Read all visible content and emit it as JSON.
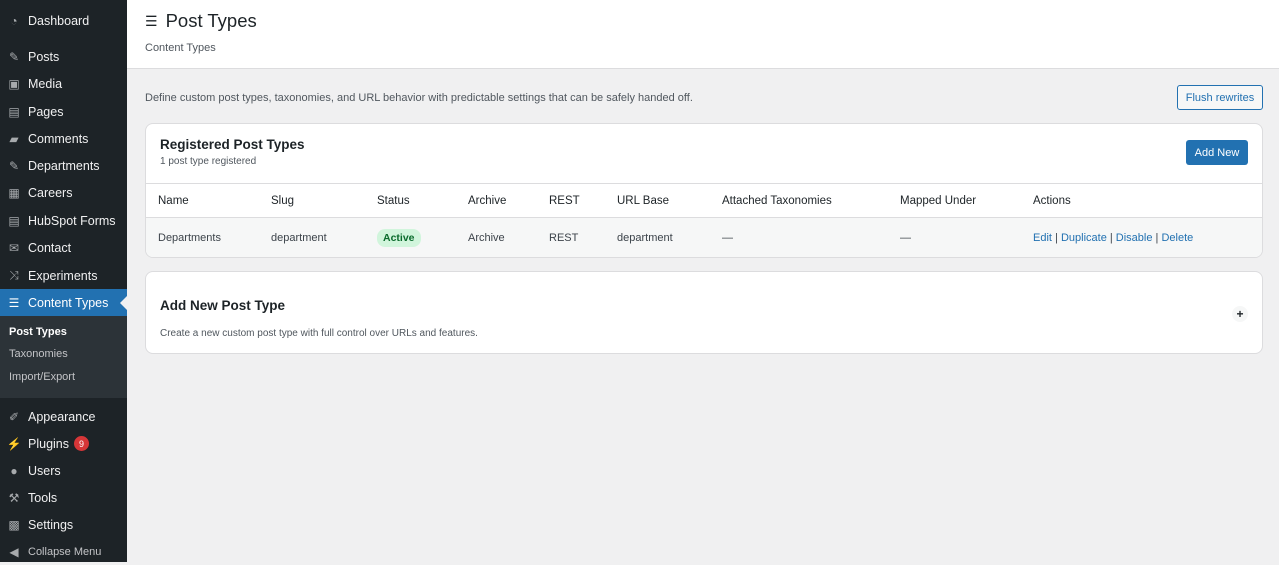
{
  "sidebar": {
    "items": [
      {
        "label": "Dashboard",
        "icon": "dashboard-icon",
        "glyph": "◔"
      },
      {
        "label": "Posts",
        "icon": "pin-icon",
        "glyph": "✎"
      },
      {
        "label": "Media",
        "icon": "media-icon",
        "glyph": "▣"
      },
      {
        "label": "Pages",
        "icon": "pages-icon",
        "glyph": "▤"
      },
      {
        "label": "Comments",
        "icon": "comment-icon",
        "glyph": "▰"
      },
      {
        "label": "Departments",
        "icon": "pin-icon",
        "glyph": "✎"
      },
      {
        "label": "Careers",
        "icon": "careers-icon",
        "glyph": "▦"
      },
      {
        "label": "HubSpot Forms",
        "icon": "form-icon",
        "glyph": "▤"
      },
      {
        "label": "Contact",
        "icon": "mail-icon",
        "glyph": "✉"
      },
      {
        "label": "Experiments",
        "icon": "shuffle-icon",
        "glyph": "⤨"
      },
      {
        "label": "Content Types",
        "icon": "database-icon",
        "glyph": "☰"
      },
      {
        "label": "Appearance",
        "icon": "brush-icon",
        "glyph": "✐"
      },
      {
        "label": "Plugins",
        "icon": "plugin-icon",
        "glyph": "⚡",
        "badge": "9"
      },
      {
        "label": "Users",
        "icon": "user-icon",
        "glyph": "●"
      },
      {
        "label": "Tools",
        "icon": "wrench-icon",
        "glyph": "⚒"
      },
      {
        "label": "Settings",
        "icon": "settings-icon",
        "glyph": "▩"
      },
      {
        "label": "Collapse Menu",
        "icon": "collapse-icon",
        "glyph": "◀"
      }
    ],
    "submenu": [
      "Post Types",
      "Taxonomies",
      "Import/Export"
    ]
  },
  "header": {
    "title": "Post Types",
    "subtitle": "Content Types"
  },
  "description": "Define custom post types, taxonomies, and URL behavior with predictable settings that can be safely handed off.",
  "flush_label": "Flush rewrites",
  "registered": {
    "title": "Registered Post Types",
    "count": "1 post type registered",
    "add_label": "Add New",
    "columns": [
      "Name",
      "Slug",
      "Status",
      "Archive",
      "REST",
      "URL Base",
      "Attached Taxonomies",
      "Mapped Under",
      "Actions"
    ],
    "rows": [
      {
        "name": "Departments",
        "slug": "department",
        "status": "Active",
        "archive": "Archive",
        "rest": "REST",
        "url_base": "department",
        "taxonomies": "—",
        "mapped": "—",
        "actions": [
          "Edit",
          "Duplicate",
          "Disable",
          "Delete"
        ]
      }
    ]
  },
  "add_new": {
    "title": "Add New Post Type",
    "description": "Create a new custom post type with full control over URLs and features.",
    "toggle": "+"
  }
}
